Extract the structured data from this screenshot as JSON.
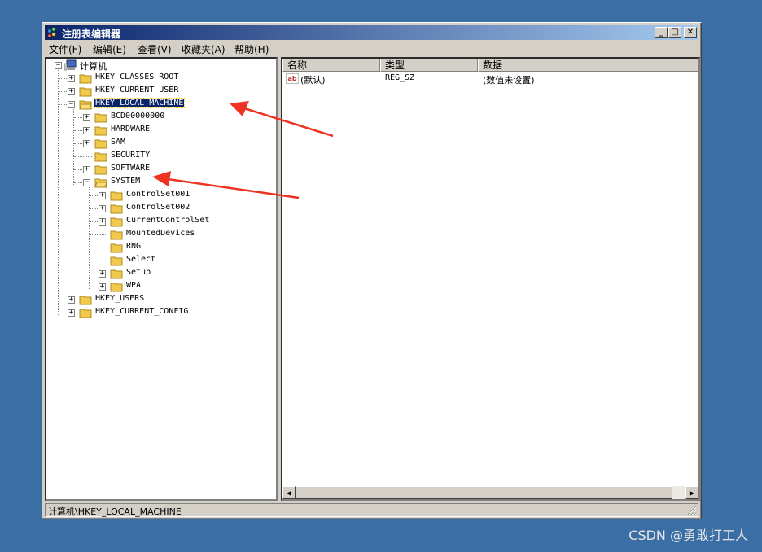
{
  "window": {
    "title": "注册表编辑器"
  },
  "title_buttons": {
    "minimize": "_",
    "maximize": "□",
    "close": "✕"
  },
  "menu": [
    "文件(F)",
    "编辑(E)",
    "查看(V)",
    "收藏夹(A)",
    "帮助(H)"
  ],
  "tree": {
    "root": "计算机",
    "nodes": [
      {
        "label": "HKEY_CLASSES_ROOT"
      },
      {
        "label": "HKEY_CURRENT_USER"
      },
      {
        "label": "HKEY_LOCAL_MACHINE",
        "selected": true,
        "expanded": true
      },
      {
        "label": "BCD00000000"
      },
      {
        "label": "HARDWARE"
      },
      {
        "label": "SAM"
      },
      {
        "label": "SECURITY"
      },
      {
        "label": "SOFTWARE"
      },
      {
        "label": "SYSTEM",
        "expanded": true
      },
      {
        "label": "ControlSet001"
      },
      {
        "label": "ControlSet002"
      },
      {
        "label": "CurrentControlSet"
      },
      {
        "label": "MountedDevices"
      },
      {
        "label": "RNG"
      },
      {
        "label": "Select"
      },
      {
        "label": "Setup"
      },
      {
        "label": "WPA"
      },
      {
        "label": "HKEY_USERS"
      },
      {
        "label": "HKEY_CURRENT_CONFIG"
      }
    ]
  },
  "list": {
    "columns": [
      "名称",
      "类型",
      "数据"
    ],
    "rows": [
      {
        "name": "(默认)",
        "type": "REG_SZ",
        "data": "(数值未设置)",
        "icon": "ab"
      }
    ]
  },
  "status": "计算机\\HKEY_LOCAL_MACHINE",
  "watermark": "CSDN @勇敢打工人",
  "colors": {
    "desktop": "#3a6ea5",
    "title_active": "#0a246a",
    "annotation_arrow": "#ee3322"
  }
}
